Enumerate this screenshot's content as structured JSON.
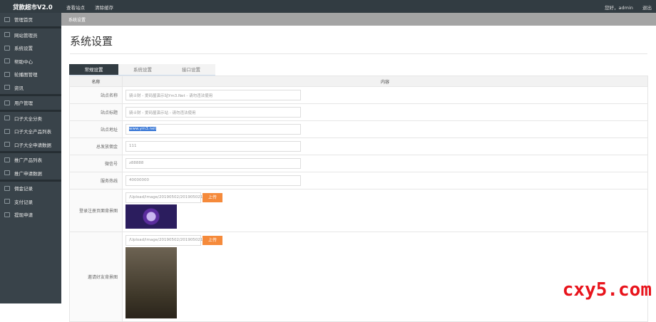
{
  "header": {
    "logo": "贷款超市V2.0",
    "nav": [
      "查看站点",
      "清除缓存"
    ],
    "greeting": "您好，admin",
    "logout": "退出"
  },
  "sidebar": {
    "groups": [
      [
        {
          "label": "管理首页",
          "icon": "home-icon"
        }
      ],
      [
        {
          "label": "网站管理员",
          "icon": "user-icon"
        },
        {
          "label": "系统设置",
          "icon": "gear-icon"
        },
        {
          "label": "帮助中心",
          "icon": "help-icon"
        },
        {
          "label": "轮播图管理",
          "icon": "file-icon"
        },
        {
          "label": "资讯",
          "icon": "news-icon"
        }
      ],
      [
        {
          "label": "用户管理",
          "icon": "users-icon"
        }
      ],
      [
        {
          "label": "口子大全分类",
          "icon": "send-icon"
        },
        {
          "label": "口子大全产品列表",
          "icon": "grid-icon"
        },
        {
          "label": "口子大全申请数据",
          "icon": "refresh-icon"
        }
      ],
      [
        {
          "label": "推广产品列表",
          "icon": "square-icon"
        },
        {
          "label": "推广申请数据",
          "icon": "edit-icon"
        }
      ],
      [
        {
          "label": "佣金记录",
          "icon": "record-icon"
        },
        {
          "label": "支付记录",
          "icon": "pay-icon"
        },
        {
          "label": "提现申请",
          "icon": "link-icon"
        }
      ]
    ]
  },
  "breadcrumb": "系统设置",
  "page_title": "系统设置",
  "tabs": [
    "常规设置",
    "系统设置",
    "接口设置"
  ],
  "table": {
    "headers": [
      "名称",
      "内容"
    ],
    "rows": [
      {
        "label": "站点名称",
        "value": "骑士财 - 爱码屋演示站Ym3.Net - 请勿违法使用"
      },
      {
        "label": "站点标题",
        "value": "骑士财 - 爱码屋演示站 - 请勿违法使用"
      },
      {
        "label": "站点地址",
        "value": "www.ym3.net"
      },
      {
        "label": "总发放佣金",
        "value": "111"
      },
      {
        "label": "微信号",
        "value": "z88888"
      },
      {
        "label": "服务热线",
        "value": "40000000"
      }
    ],
    "uploads": [
      {
        "label": "登录注册页面背景图",
        "value": "/Upload/image/20190502/2019050215-",
        "button": "上传"
      },
      {
        "label": "邀请好友背景图",
        "value": "/Upload/image/20190502/2019050215-",
        "button": "上传"
      }
    ]
  },
  "watermark": "cxy5.com"
}
